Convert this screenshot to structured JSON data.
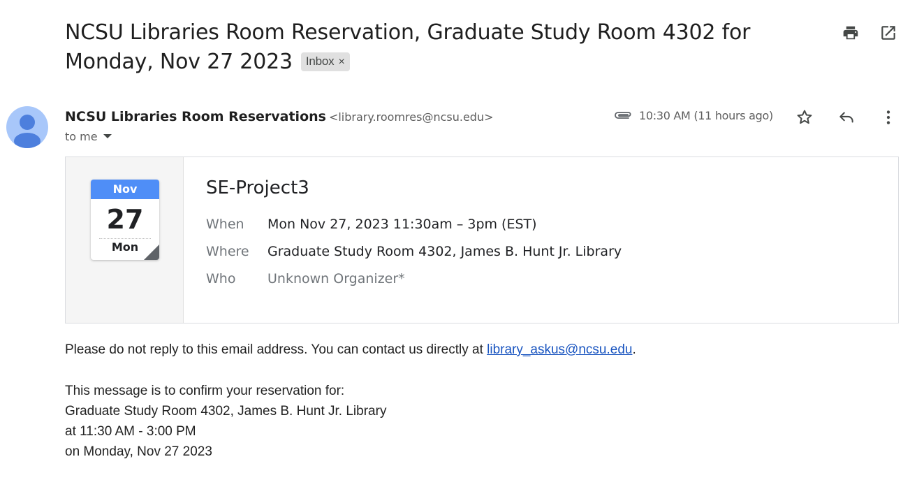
{
  "email": {
    "subject": "NCSU Libraries Room Reservation, Graduate Study Room 4302 for Monday, Nov 27 2023",
    "label_chip": "Inbox",
    "label_remove": "×",
    "sender_name": "NCSU Libraries Room Reservations",
    "sender_email": "<library.roomres@ncsu.edu>",
    "recipient": "to me",
    "timestamp": "10:30 AM (11 hours ago)"
  },
  "icons": {
    "print": "print-icon",
    "open_new_window": "open-in-new-icon",
    "attachment": "paperclip-icon",
    "star": "star-icon",
    "reply": "reply-icon",
    "more": "more-vert-icon",
    "avatar": "person-avatar-icon"
  },
  "event": {
    "calendar_month": "Nov",
    "calendar_day": "27",
    "calendar_weekday": "Mon",
    "title": "SE-Project3",
    "rows": [
      {
        "label": "When",
        "value": "Mon Nov 27, 2023 11:30am – 3pm (EST)"
      },
      {
        "label": "Where",
        "value": "Graduate Study Room 4302, James B. Hunt Jr. Library"
      },
      {
        "label": "Who",
        "value": "Unknown Organizer*"
      }
    ]
  },
  "body": {
    "notice_prefix": "Please do not reply to this email address. You can contact us directly at ",
    "notice_link": "library_askus@ncsu.edu",
    "notice_suffix": ".",
    "lines": [
      "This message is to confirm your reservation for:",
      "Graduate Study Room 4302, James B. Hunt Jr. Library",
      "at 11:30 AM - 3:00 PM",
      "on Monday, Nov 27 2023"
    ]
  },
  "colors": {
    "calendar_header": "#4f8ef7",
    "link": "#1a55c0",
    "avatar_bg": "#a8c7fa",
    "avatar_fg": "#4d7fdd"
  }
}
